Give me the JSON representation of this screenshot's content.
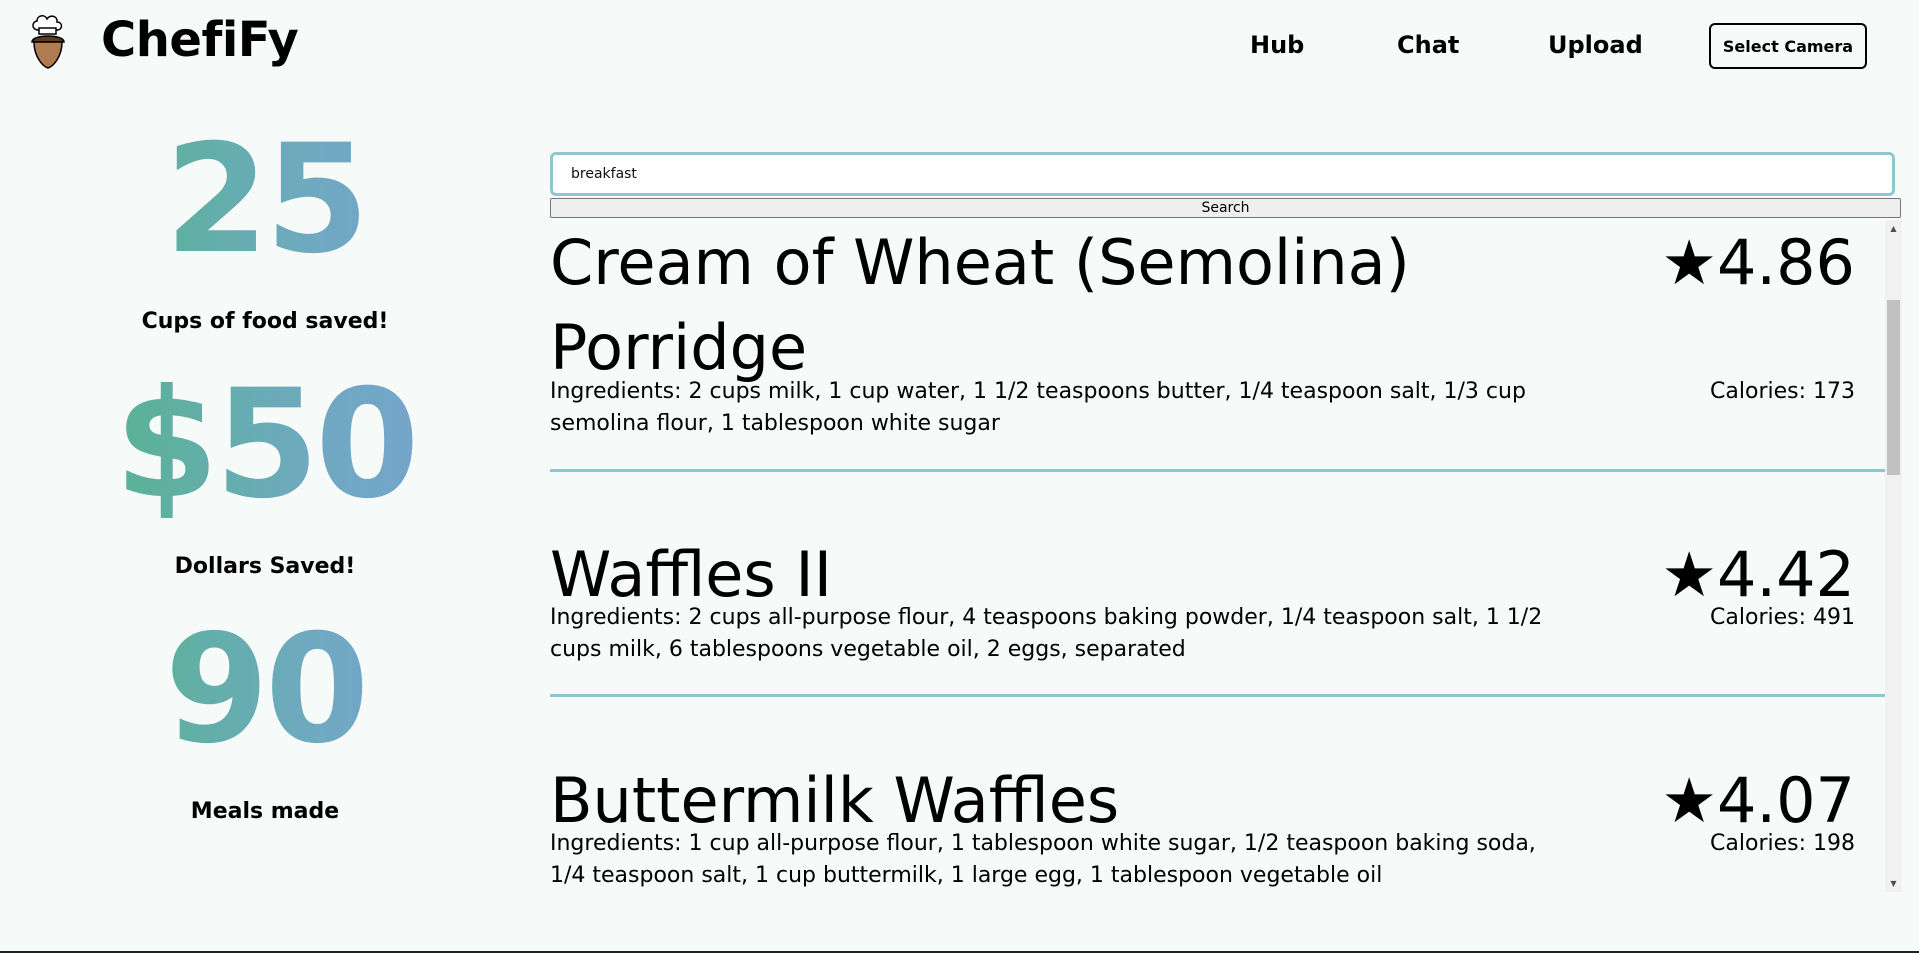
{
  "brand": "ChefiFy",
  "nav": {
    "hub": "Hub",
    "chat": "Chat",
    "upload": "Upload",
    "camera_button": "Select Camera"
  },
  "stats": [
    {
      "value": "25",
      "label": "Cups of food saved!"
    },
    {
      "value": "$50",
      "label": "Dollars Saved!"
    },
    {
      "value": "90",
      "label": "Meals made"
    }
  ],
  "search": {
    "value": "breakfast",
    "button": "Search"
  },
  "results": [
    {
      "title": "Cream of Wheat (Semolina) Porridge",
      "rating": "★4.86",
      "ingredients": "Ingredients: 2 cups milk, 1 cup water, 1 1/2 teaspoons butter, 1/4 teaspoon salt, 1/3 cup semolina flour, 1 tablespoon white sugar",
      "calories": "Calories: 173"
    },
    {
      "title": "Waffles II",
      "rating": "★4.42",
      "ingredients": "Ingredients: 2 cups all-purpose flour, 4 teaspoons baking powder, 1/4 teaspoon salt, 1 1/2 cups milk, 6 tablespoons vegetable oil, 2 eggs, separated",
      "calories": "Calories: 491"
    },
    {
      "title": "Buttermilk Waffles",
      "rating": "★4.07",
      "ingredients": "Ingredients: 1 cup all-purpose flour, 1 tablespoon white sugar, 1/2 teaspoon baking soda, 1/4 teaspoon salt, 1 cup buttermilk, 1 large egg, 1 tablespoon vegetable oil",
      "calories": "Calories: 198"
    }
  ],
  "colors": {
    "gradient_start": "#4db87a",
    "gradient_end": "#7b9fd4",
    "accent_border": "#8fc7cf",
    "background": "#f6faf8"
  },
  "icons": {
    "logo": "acorn-chef-hat-icon",
    "scroll_up": "triangle-up-icon",
    "scroll_down": "triangle-down-icon"
  }
}
